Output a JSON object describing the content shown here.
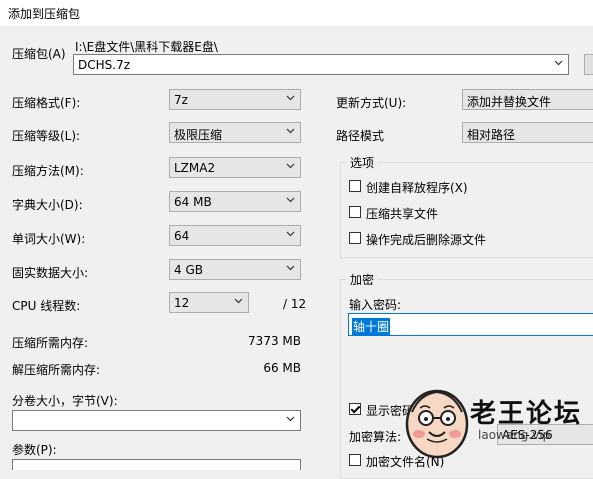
{
  "window": {
    "title": "添加到压缩包"
  },
  "archive": {
    "label": "压缩包(A)",
    "path": "I:\\E盘文件\\黑科下载器E盘\\",
    "name": "DCHS.7z"
  },
  "left": {
    "format": {
      "label": "压缩格式(F):",
      "value": "7z"
    },
    "level": {
      "label": "压缩等级(L):",
      "value": "极限压缩"
    },
    "method": {
      "label": "压缩方法(M):",
      "value": "LZMA2"
    },
    "dict": {
      "label": "字典大小(D):",
      "value": "64 MB"
    },
    "word": {
      "label": "单词大小(W):",
      "value": "64"
    },
    "solid": {
      "label": "固实数据大小:",
      "value": "4 GB"
    },
    "threads": {
      "label": "CPU 线程数:",
      "value": "12",
      "max": "/ 12"
    },
    "mem_comp": {
      "label": "压缩所需内存:",
      "value": "7373 MB"
    },
    "mem_decomp": {
      "label": "解压缩所需内存:",
      "value": "66 MB"
    },
    "split": {
      "label": "分卷大小，字节(V):",
      "value": ""
    },
    "params": {
      "label": "参数(P):",
      "value": ""
    }
  },
  "right": {
    "update": {
      "label": "更新方式(U):",
      "value": "添加并替换文件"
    },
    "pathmode": {
      "label": "路径模式",
      "value": "相对路径"
    },
    "options": {
      "caption": "选项",
      "sfx": "创建自释放程序(X)",
      "shared": "压缩共享文件",
      "delete": "操作完成后删除源文件"
    },
    "encrypt": {
      "caption": "加密",
      "pw_label": "输入密码:",
      "pw_value": "轴十圈",
      "show_pw": "显示密码",
      "method_label": "加密算法:",
      "method_value": "AES-256",
      "encrypt_names": "加密文件名(N)"
    }
  },
  "watermark": {
    "title": "老王论坛",
    "url": "laowang.vip"
  }
}
